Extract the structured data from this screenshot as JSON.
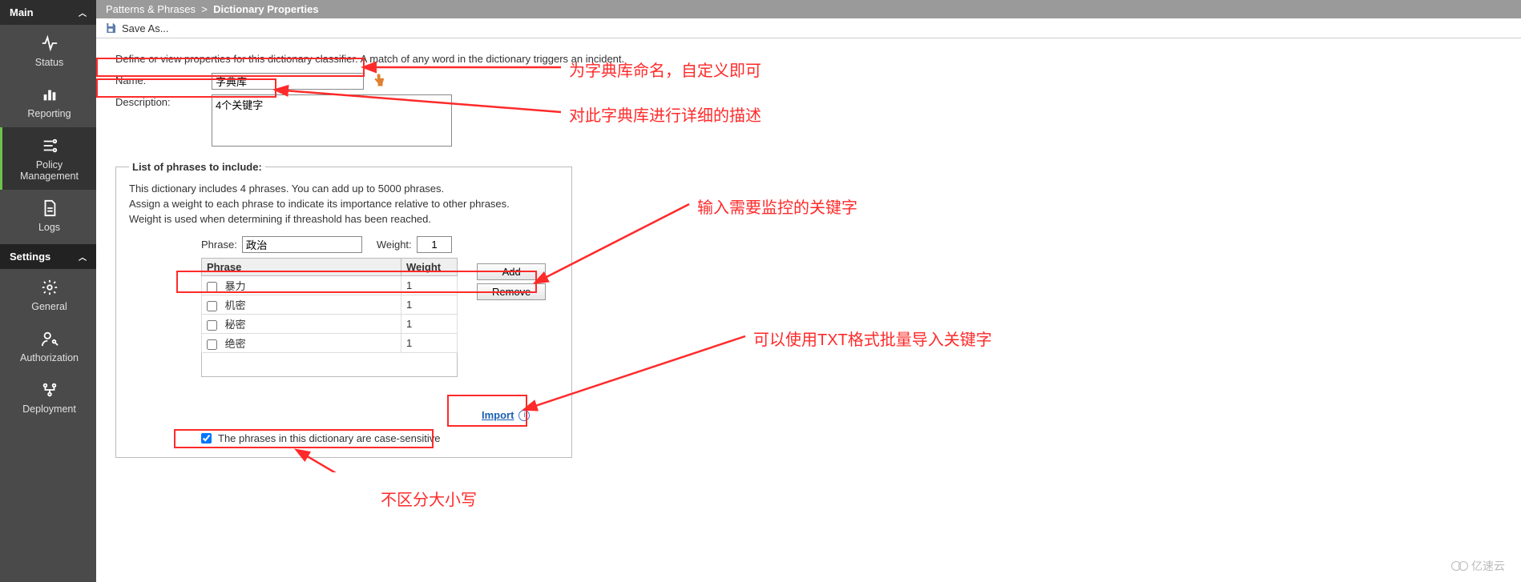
{
  "sidebar": {
    "main_label": "Main",
    "settings_label": "Settings",
    "items_main": [
      {
        "label": "Status",
        "icon": "pulse-icon"
      },
      {
        "label": "Reporting",
        "icon": "bar-chart-icon"
      },
      {
        "label": "Policy Management",
        "icon": "policy-icon",
        "active": true
      },
      {
        "label": "Logs",
        "icon": "logs-icon"
      }
    ],
    "items_settings": [
      {
        "label": "General",
        "icon": "gear-icon"
      },
      {
        "label": "Authorization",
        "icon": "user-key-icon"
      },
      {
        "label": "Deployment",
        "icon": "deploy-icon"
      }
    ]
  },
  "breadcrumb": {
    "parent": "Patterns & Phrases",
    "separator": ">",
    "current": "Dictionary Properties"
  },
  "toolbar": {
    "save_as_label": "Save As..."
  },
  "page": {
    "intro": "Define or view properties for this dictionary classifier. A match of any word in the dictionary triggers an incident.",
    "name_label": "Name:",
    "name_value": "字典库",
    "description_label": "Description:",
    "description_value": "4个关键字"
  },
  "phrases_section": {
    "legend": "List of phrases to include:",
    "desc1": "This dictionary includes 4 phrases. You can add up to 5000 phrases.",
    "desc2": "Assign a weight to each phrase to indicate its importance relative to other phrases.",
    "desc3": "Weight is used when determining if threashold has been reached.",
    "phrase_label": "Phrase:",
    "phrase_value": "政治",
    "weight_label": "Weight:",
    "weight_value": "1",
    "add_label": "Add",
    "remove_label": "Remove",
    "table_headers": {
      "phrase": "Phrase",
      "weight": "Weight"
    },
    "rows": [
      {
        "phrase": "暴力",
        "weight": "1"
      },
      {
        "phrase": "机密",
        "weight": "1"
      },
      {
        "phrase": "秘密",
        "weight": "1"
      },
      {
        "phrase": "绝密",
        "weight": "1"
      }
    ],
    "import_label": "Import",
    "case_sensitive_label": "The phrases in this dictionary are case-sensitive"
  },
  "annotations": {
    "name_hint": "为字典库命名，自定义即可",
    "desc_hint": "对此字典库进行详细的描述",
    "phrase_hint": "输入需要监控的关键字",
    "import_hint": "可以使用TXT格式批量导入关键字",
    "case_hint": "不区分大小写"
  },
  "watermark": "亿速云"
}
